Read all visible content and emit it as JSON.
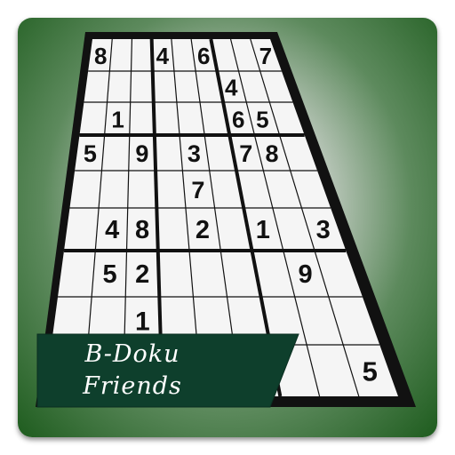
{
  "logo": {
    "line1": "B-Doku",
    "line2": "Friends"
  },
  "colors": {
    "background_dark": "#1e5c1e",
    "banner": "#0e3f2c",
    "grid": "#111111",
    "cell": "#f5f5f5"
  },
  "clues": [
    {
      "row": 0,
      "col": 0,
      "value": "8"
    },
    {
      "row": 0,
      "col": 3,
      "value": "4"
    },
    {
      "row": 0,
      "col": 5,
      "value": "6"
    },
    {
      "row": 0,
      "col": 8,
      "value": "7"
    },
    {
      "row": 1,
      "col": 6,
      "value": "4"
    },
    {
      "row": 2,
      "col": 1,
      "value": "1"
    },
    {
      "row": 2,
      "col": 6,
      "value": "6"
    },
    {
      "row": 2,
      "col": 7,
      "value": "5"
    },
    {
      "row": 3,
      "col": 0,
      "value": "5"
    },
    {
      "row": 3,
      "col": 2,
      "value": "9"
    },
    {
      "row": 3,
      "col": 4,
      "value": "3"
    },
    {
      "row": 3,
      "col": 6,
      "value": "7"
    },
    {
      "row": 3,
      "col": 7,
      "value": "8"
    },
    {
      "row": 4,
      "col": 4,
      "value": "7"
    },
    {
      "row": 5,
      "col": 1,
      "value": "4"
    },
    {
      "row": 5,
      "col": 2,
      "value": "8"
    },
    {
      "row": 5,
      "col": 4,
      "value": "2"
    },
    {
      "row": 5,
      "col": 6,
      "value": "1"
    },
    {
      "row": 5,
      "col": 8,
      "value": "3"
    },
    {
      "row": 6,
      "col": 1,
      "value": "5"
    },
    {
      "row": 6,
      "col": 2,
      "value": "2"
    },
    {
      "row": 6,
      "col": 7,
      "value": "9"
    },
    {
      "row": 7,
      "col": 2,
      "value": "1"
    },
    {
      "row": 8,
      "col": 8,
      "value": "5"
    }
  ]
}
